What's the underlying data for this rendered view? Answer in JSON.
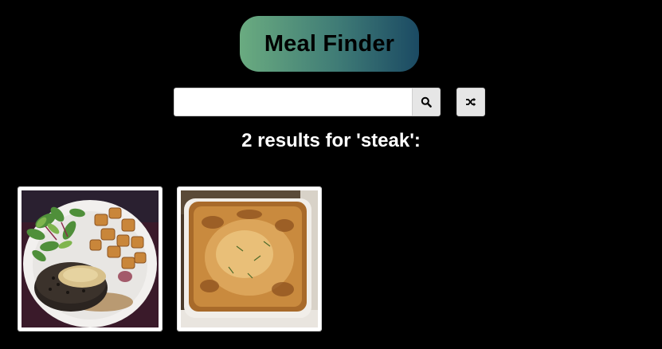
{
  "app": {
    "title": "Meal Finder"
  },
  "search": {
    "value": "",
    "placeholder": "",
    "search_icon": "search-icon",
    "random_icon": "shuffle-icon"
  },
  "results": {
    "heading": "2 results for 'steak':",
    "query": "steak",
    "count": 2,
    "meals": [
      {
        "image": "steak-with-salad-and-potatoes"
      },
      {
        "image": "steak-pie"
      }
    ]
  },
  "colors": {
    "background": "#000000",
    "title_gradient_start": "#6aab80",
    "title_gradient_end": "#1b4a63",
    "card_border": "#ffffff",
    "button_bg": "#e6e6e6"
  }
}
